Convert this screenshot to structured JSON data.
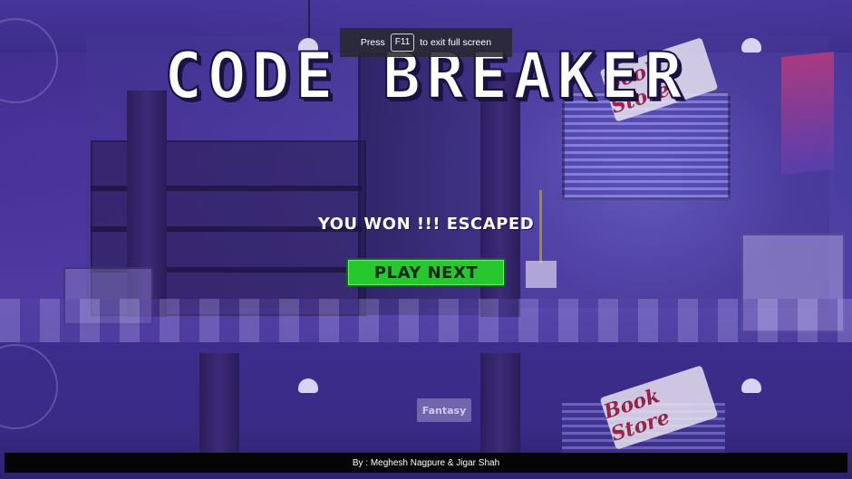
{
  "toast": {
    "press": "Press",
    "key": "F11",
    "suffix": "to exit full screen"
  },
  "game": {
    "title": "CODE BREAKER",
    "status": "YOU WON !!! ESCAPED",
    "play_next_label": "PLAY NEXT"
  },
  "scene": {
    "sign_text": "Book Store",
    "fantasy_label": "Fantasy"
  },
  "footer": {
    "credits": "By : Meghesh Nagpure & Jigar Shah"
  },
  "colors": {
    "button_green": "#27c82f",
    "background_purple": "#3a2a86"
  }
}
